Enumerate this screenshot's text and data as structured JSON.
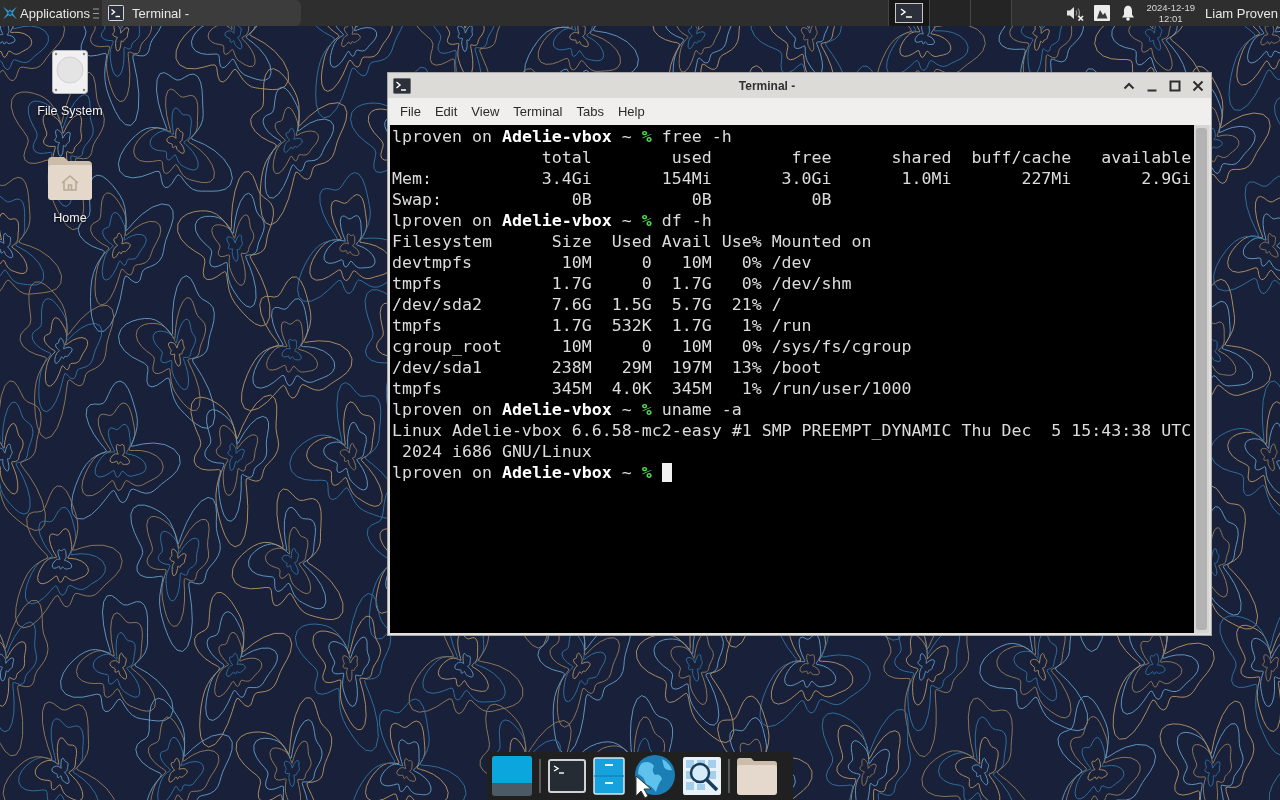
{
  "top_panel": {
    "menu_label": "Applications",
    "tasks": [
      {
        "title": "Terminal -",
        "selected": true
      }
    ],
    "workspaces": [
      {
        "selected": true,
        "has_window": true
      },
      {
        "selected": false,
        "has_window": false
      },
      {
        "selected": false,
        "has_window": false
      }
    ],
    "volume": {
      "muted": true
    },
    "clock": {
      "date": "2024-12-19",
      "time": "12:01"
    },
    "user_name": "Liam Proven"
  },
  "desktop_icons": [
    {
      "kind": "drive",
      "label": "File System"
    },
    {
      "kind": "home",
      "label": "Home"
    }
  ],
  "window": {
    "title": "Terminal -",
    "menu": [
      "File",
      "Edit",
      "View",
      "Terminal",
      "Tabs",
      "Help"
    ],
    "terminal": {
      "lines": [
        {
          "kind": "prompt",
          "user": "lproven",
          "joiner": "on",
          "host": "Adelie-vbox",
          "dir": "~",
          "symbol": "%",
          "command": "free -h"
        },
        {
          "kind": "output",
          "text": "               total        used        free      shared  buff/cache   available"
        },
        {
          "kind": "output",
          "text": "Mem:           3.4Gi       154Mi       3.0Gi       1.0Mi       227Mi       2.9Gi"
        },
        {
          "kind": "output",
          "text": "Swap:             0B          0B          0B"
        },
        {
          "kind": "prompt",
          "user": "lproven",
          "joiner": "on",
          "host": "Adelie-vbox",
          "dir": "~",
          "symbol": "%",
          "command": "df -h"
        },
        {
          "kind": "output",
          "text": "Filesystem      Size  Used Avail Use% Mounted on"
        },
        {
          "kind": "output",
          "text": "devtmpfs         10M     0   10M   0% /dev"
        },
        {
          "kind": "output",
          "text": "tmpfs           1.7G     0  1.7G   0% /dev/shm"
        },
        {
          "kind": "output",
          "text": "/dev/sda2       7.6G  1.5G  5.7G  21% /"
        },
        {
          "kind": "output",
          "text": "tmpfs           1.7G  532K  1.7G   1% /run"
        },
        {
          "kind": "output",
          "text": "cgroup_root      10M     0   10M   0% /sys/fs/cgroup"
        },
        {
          "kind": "output",
          "text": "/dev/sda1       238M   29M  197M  13% /boot"
        },
        {
          "kind": "output",
          "text": "tmpfs           345M  4.0K  345M   1% /run/user/1000"
        },
        {
          "kind": "prompt",
          "user": "lproven",
          "joiner": "on",
          "host": "Adelie-vbox",
          "dir": "~",
          "symbol": "%",
          "command": "uname -a"
        },
        {
          "kind": "output",
          "text": "Linux Adelie-vbox 6.6.58-mc2-easy #1 SMP PREEMPT_DYNAMIC Thu Dec  5 15:43:38 UTC"
        },
        {
          "kind": "output",
          "text": " 2024 i686 GNU/Linux"
        },
        {
          "kind": "prompt",
          "user": "lproven",
          "joiner": "on",
          "host": "Adelie-vbox",
          "dir": "~",
          "symbol": "%",
          "cursor": true
        }
      ]
    }
  }
}
